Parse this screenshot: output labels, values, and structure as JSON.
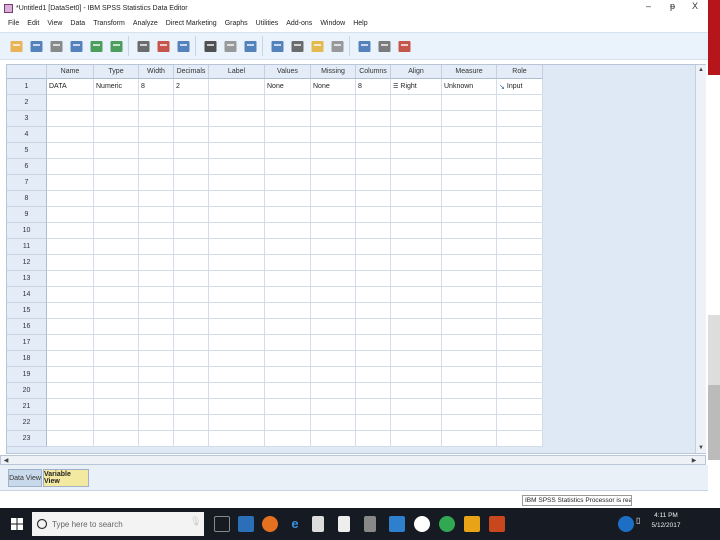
{
  "window": {
    "title": "*Untitled1 [DataSet0] - IBM SPSS Statistics Data Editor",
    "min": "–",
    "max": "ᵽ",
    "close": "X"
  },
  "menu": [
    "File",
    "Edit",
    "View",
    "Data",
    "Transform",
    "Analyze",
    "Direct Marketing",
    "Graphs",
    "Utilities",
    "Add-ons",
    "Window",
    "Help"
  ],
  "toolbar_icons": [
    "open-icon",
    "save-icon",
    "print-icon",
    "dialog-recall-icon",
    "undo-icon",
    "redo-icon",
    "goto-case-icon",
    "goto-variable-icon",
    "variables-icon",
    "find-icon",
    "insert-cases-icon",
    "insert-variable-icon",
    "split-file-icon",
    "weight-cases-icon",
    "select-cases-icon",
    "value-labels-icon",
    "use-sets-icon",
    "show-all-icon",
    "spelling-icon"
  ],
  "columns": [
    "Name",
    "Type",
    "Width",
    "Decimals",
    "Label",
    "Values",
    "Missing",
    "Columns",
    "Align",
    "Measure",
    "Role"
  ],
  "row_numbers": [
    "1",
    "2",
    "3",
    "4",
    "5",
    "6",
    "7",
    "8",
    "9",
    "10",
    "11",
    "12",
    "13",
    "14",
    "15",
    "16",
    "17",
    "18",
    "19",
    "20",
    "21",
    "22",
    "23"
  ],
  "variables": [
    {
      "name": "DATA",
      "type": "Numeric",
      "width": "8",
      "decimals": "2",
      "label": "",
      "values": "None",
      "missing": "None",
      "columns": "8",
      "align": "Right",
      "measure": "Unknown",
      "role": "Input"
    }
  ],
  "tabs": {
    "data_view": "Data View",
    "variable_view": "Variable View",
    "active": "variable_view"
  },
  "status": "IBM SPSS Statistics Processor is ready",
  "taskbar": {
    "search_placeholder": "Type here to search",
    "time": "4:11 PM",
    "date": "5/12/2017"
  },
  "colors": {
    "accent_red": "#b5151b",
    "grid_header": "#e4ecf7",
    "active_tab": "#f3e9a0"
  }
}
